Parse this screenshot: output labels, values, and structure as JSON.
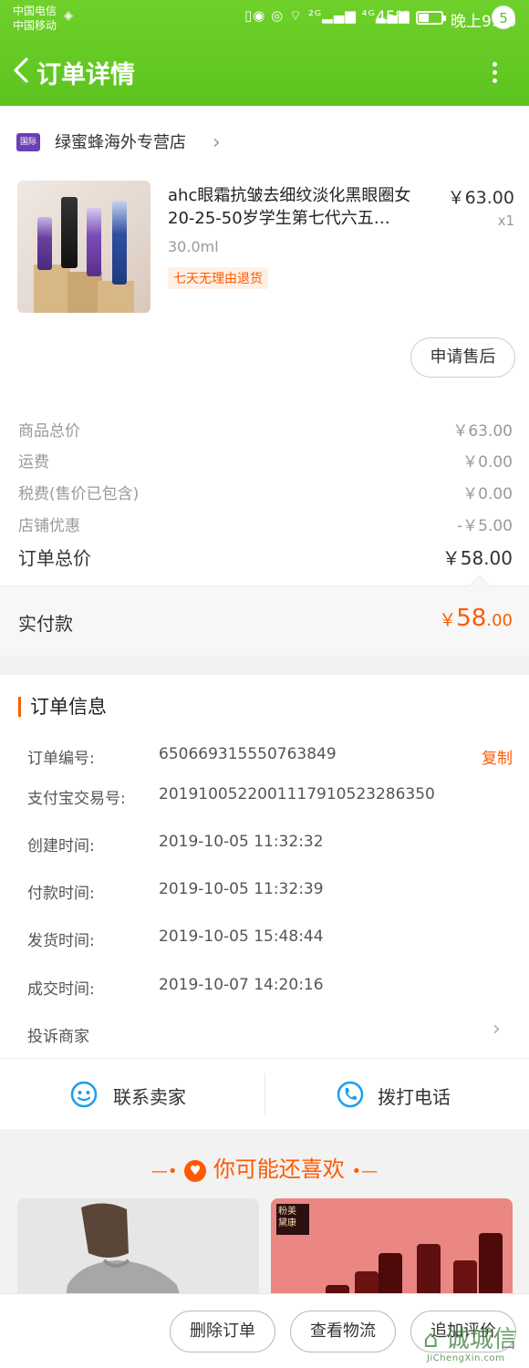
{
  "status_bar": {
    "carrier1": "中国电信",
    "carrier2": "中国移动",
    "icons": "▯◉ ◎ ⌔ ²ᴳ▂▄▆ ⁴ᴳ▂▄▆",
    "battery_percent": "45%",
    "battery_level": 0.45,
    "time": "晚上9:10"
  },
  "nav": {
    "title": "订单详情",
    "notification_count": "5"
  },
  "shop": {
    "badge": "国际",
    "name": "绿蜜蜂海外专营店"
  },
  "product": {
    "title": "ahc眼霜抗皱去细纹淡化黑眼圈女20-25-50岁学生第七代六五…",
    "spec": "30.0ml",
    "tag": "七天无理由退货",
    "price": "￥63.00",
    "quantity": "x1"
  },
  "after_sale_button": "申请售后",
  "fees": [
    {
      "label": "商品总价",
      "value": "￥63.00"
    },
    {
      "label": "运费",
      "value": "￥0.00"
    },
    {
      "label": "税费(售价已包含)",
      "value": "￥0.00"
    },
    {
      "label": "店铺优惠",
      "value": "-￥5.00"
    }
  ],
  "order_total": {
    "label": "订单总价",
    "value": "￥58.00"
  },
  "paid": {
    "label": "实付款",
    "symbol": "￥",
    "integer": "58",
    "decimal": ".00"
  },
  "order_info": {
    "title": "订单信息",
    "copy_label": "复制",
    "rows": [
      {
        "key": "订单编号:",
        "value": "650669315550763849"
      },
      {
        "key": "支付宝交易号:",
        "value": "2019100522001117910523286350"
      },
      {
        "key": "创建时间:",
        "value": "2019-10-05 11:32:32"
      },
      {
        "key": "付款时间:",
        "value": "2019-10-05 11:32:39"
      },
      {
        "key": "发货时间:",
        "value": "2019-10-05 15:48:44"
      },
      {
        "key": "成交时间:",
        "value": "2019-10-07 14:20:16"
      }
    ],
    "complain": "投诉商家"
  },
  "contact": {
    "seller": "联系卖家",
    "phone": "拨打电话"
  },
  "recommend": {
    "title": "你可能还喜欢",
    "card2_text": "粉美\n黛康"
  },
  "bottom_buttons": [
    "删除订单",
    "查看物流",
    "追加评价"
  ],
  "watermark": {
    "main": "⌂ 诚城信",
    "sub": "JiChengXin.com"
  },
  "colors": {
    "brand_green": "#5cc41f",
    "accent_orange": "#ff5a00"
  }
}
